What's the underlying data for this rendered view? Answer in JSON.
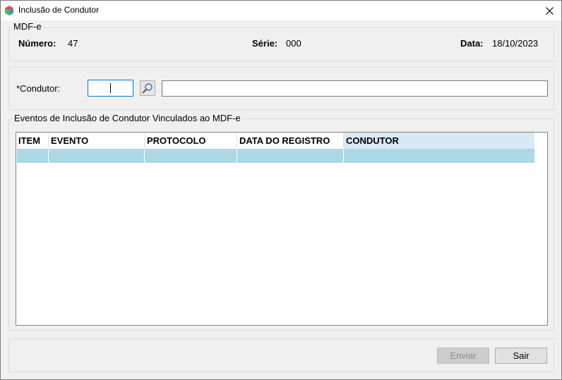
{
  "window": {
    "title": "Inclusão de Condutor"
  },
  "mdfe": {
    "legend": "MDF-e",
    "numero_label": "Número:",
    "numero_value": "47",
    "serie_label": "Série:",
    "serie_value": "000",
    "data_label": "Data:",
    "data_value": "18/10/2023"
  },
  "condutor": {
    "label": "*Condutor:",
    "code_value": "",
    "name_value": ""
  },
  "eventos": {
    "legend": "Eventos de Inclusão de Condutor Vinculados ao MDF-e",
    "columns": [
      "ITEM",
      "EVENTO",
      "PROTOCOLO",
      "DATA DO REGISTRO",
      "CONDUTOR"
    ],
    "rows": [
      [
        "",
        "",
        "",
        "",
        ""
      ]
    ],
    "selected_row_color": "#add8e6"
  },
  "buttons": {
    "enviar": "Enviar",
    "sair": "Sair"
  }
}
